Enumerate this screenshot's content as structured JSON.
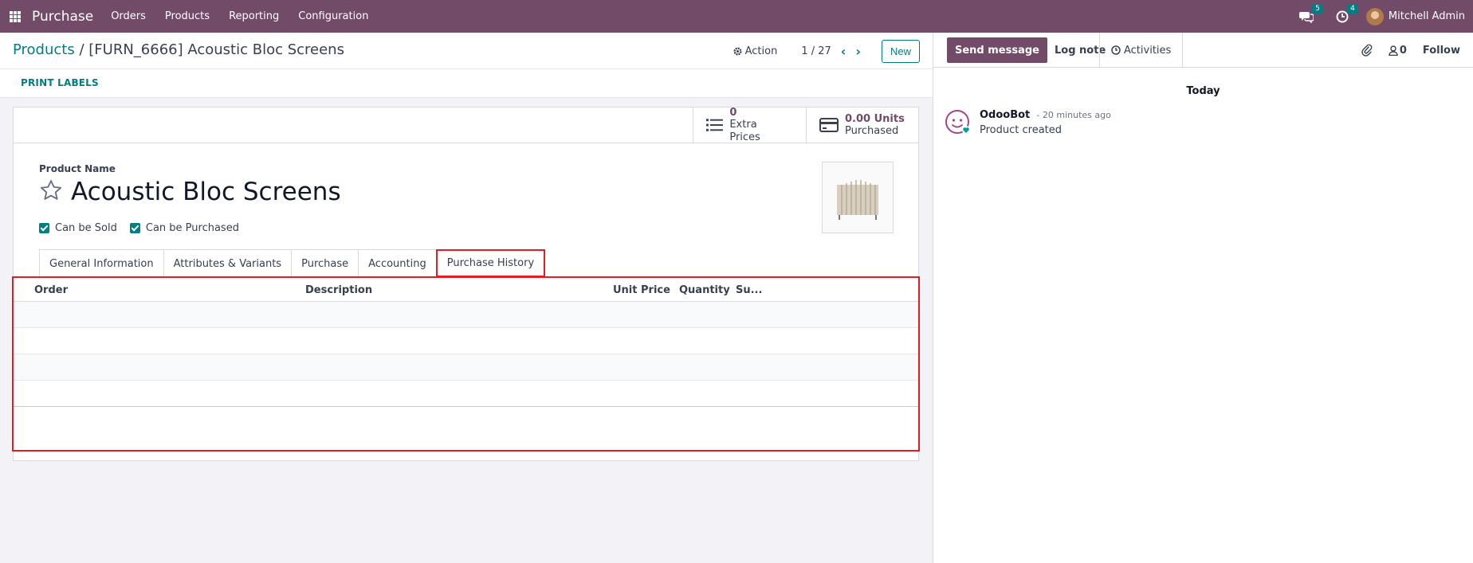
{
  "topnav": {
    "app_name": "Purchase",
    "menu": [
      "Orders",
      "Products",
      "Reporting",
      "Configuration"
    ],
    "messages_badge": "5",
    "activities_badge": "4",
    "user_name": "Mitchell Admin"
  },
  "control_panel": {
    "breadcrumb_parent": "Products",
    "breadcrumb_sep": "/",
    "breadcrumb_current": "[FURN_6666] Acoustic Bloc Screens",
    "action_label": "Action",
    "pager": "1 / 27",
    "new_label": "New"
  },
  "statusbar": {
    "print_labels": "PRINT LABELS"
  },
  "smart_buttons": {
    "extra_prices_value": "0",
    "extra_prices_label": "Extra Prices",
    "purchased_value": "0.00 Units",
    "purchased_label": "Purchased"
  },
  "product": {
    "name_label": "Product Name",
    "name": "Acoustic Bloc Screens",
    "can_be_sold": "Can be Sold",
    "can_be_purchased": "Can be Purchased"
  },
  "tabs": [
    "General Information",
    "Attributes & Variants",
    "Purchase",
    "Accounting",
    "Purchase History"
  ],
  "history_table": {
    "columns": [
      "Order",
      "Description",
      "Unit Price",
      "Quantity",
      "Su..."
    ]
  },
  "chatter": {
    "send_message": "Send message",
    "log_note": "Log note",
    "activities": "Activities",
    "followers_count": "0",
    "follow": "Follow",
    "date_separator": "Today",
    "message": {
      "author": "OdooBot",
      "time": "- 20 minutes ago",
      "body": "Product created"
    }
  },
  "colors": {
    "brand": "#714b67",
    "accent": "#017e84",
    "highlight": "#e11d26"
  }
}
